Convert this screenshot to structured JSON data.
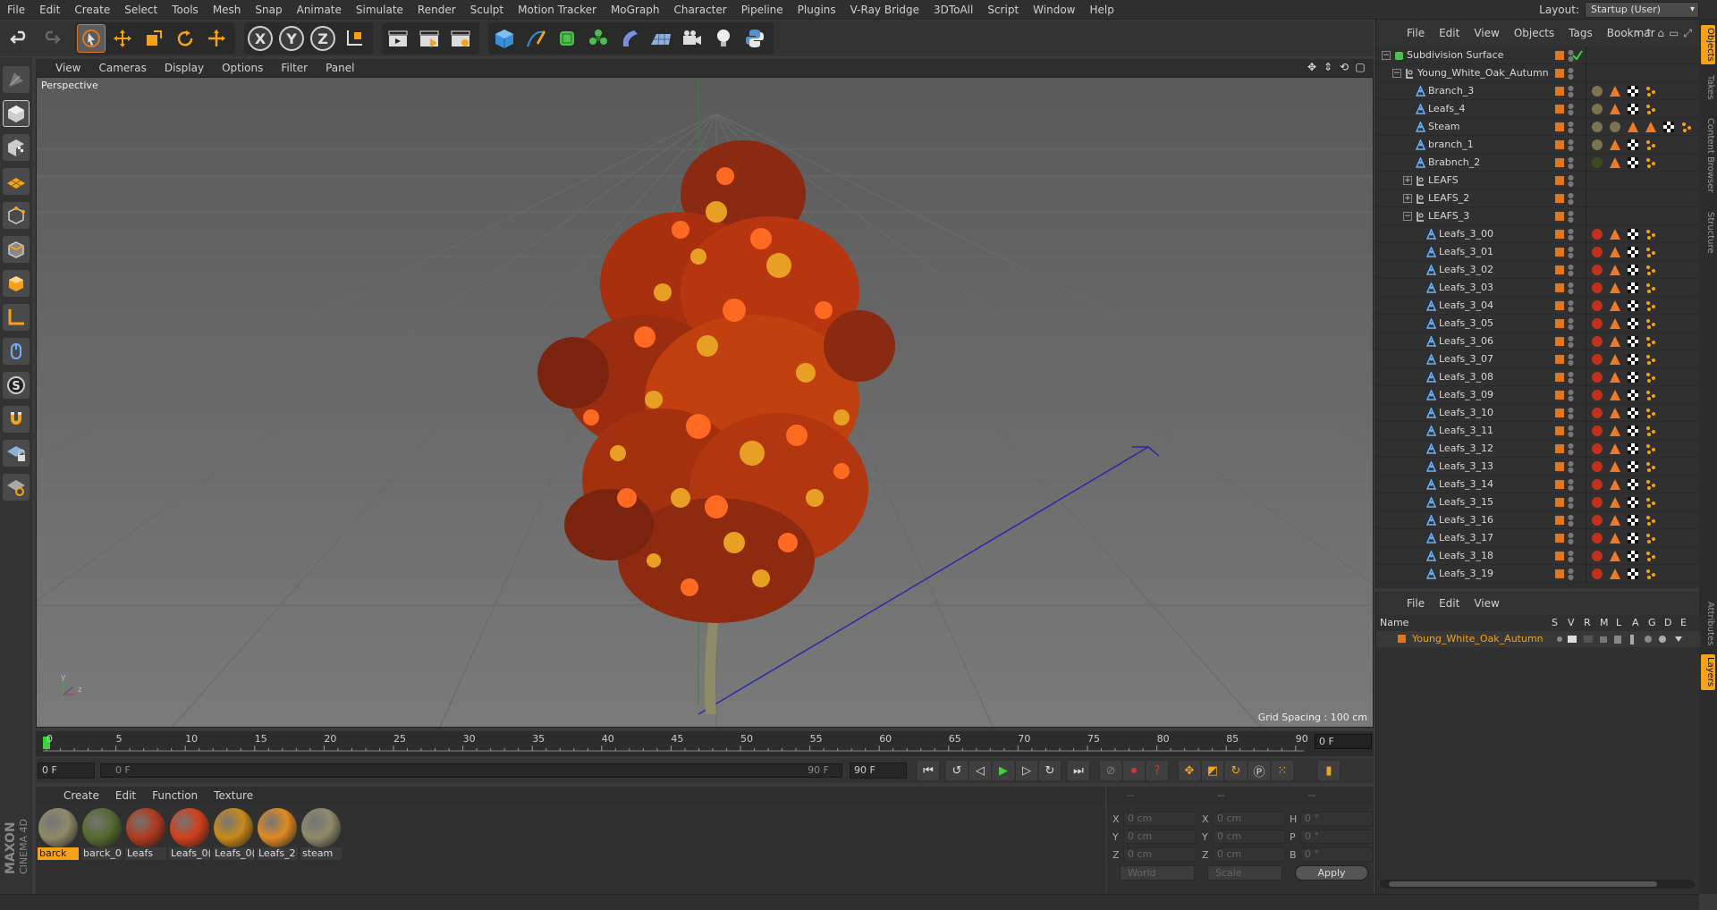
{
  "menubar": {
    "items": [
      "File",
      "Edit",
      "Create",
      "Select",
      "Tools",
      "Mesh",
      "Snap",
      "Animate",
      "Simulate",
      "Render",
      "Sculpt",
      "Motion Tracker",
      "MoGraph",
      "Character",
      "Pipeline",
      "Plugins",
      "V-Ray Bridge",
      "3DToAll",
      "Script",
      "Window",
      "Help"
    ],
    "layout_label": "Layout:",
    "layout_value": "Startup (User)"
  },
  "toolbar": {
    "axis_x": "X",
    "axis_y": "Y",
    "axis_z": "Z"
  },
  "viewport": {
    "menus": [
      "View",
      "Cameras",
      "Display",
      "Options",
      "Filter",
      "Panel"
    ],
    "label": "Perspective",
    "grid_spacing": "Grid Spacing : 100 cm",
    "axis_y": "y",
    "axis_z": "z"
  },
  "timeline": {
    "ticks": [
      "0",
      "5",
      "10",
      "15",
      "20",
      "25",
      "30",
      "35",
      "40",
      "45",
      "50",
      "55",
      "60",
      "65",
      "70",
      "75",
      "80",
      "85",
      "90"
    ],
    "current_frame": "0 F"
  },
  "playbar": {
    "start_field": "0 F",
    "range_start": "0 F",
    "range_end": "90 F",
    "end_field": "90 F"
  },
  "materials": {
    "menus": [
      "Create",
      "Edit",
      "Function",
      "Texture"
    ],
    "items": [
      {
        "name": "barck",
        "color": "#8f8a68"
      },
      {
        "name": "barck_0(",
        "color": "#556b2f"
      },
      {
        "name": "Leafs",
        "color": "#b03a1e"
      },
      {
        "name": "Leafs_0(",
        "color": "#d2401a"
      },
      {
        "name": "Leafs_0(",
        "color": "#c98a1a"
      },
      {
        "name": "Leafs_2",
        "color": "#e08a22"
      },
      {
        "name": "steam",
        "color": "#8f8a68"
      }
    ]
  },
  "coords": {
    "header": [
      "--",
      "--",
      "--"
    ],
    "rows": [
      {
        "a_label": "X",
        "a_value": "0 cm",
        "b_label": "X",
        "b_value": "0 cm",
        "c_label": "H",
        "c_value": "0 °"
      },
      {
        "a_label": "Y",
        "a_value": "0 cm",
        "b_label": "Y",
        "b_value": "0 cm",
        "c_label": "P",
        "c_value": "0 °"
      },
      {
        "a_label": "Z",
        "a_value": "0 cm",
        "b_label": "Z",
        "b_value": "0 cm",
        "c_label": "B",
        "c_value": "0 °"
      }
    ],
    "mode": "World",
    "scale": "Scale",
    "apply": "Apply"
  },
  "object_manager": {
    "menus": [
      "File",
      "Edit",
      "View",
      "Objects",
      "Tags",
      "Bookmar"
    ],
    "rows": [
      {
        "name": "Subdivision Surface",
        "indent": 0,
        "kind": "subdiv"
      },
      {
        "name": "Young_White_Oak_Autumn",
        "indent": 1,
        "kind": "null"
      },
      {
        "name": "Branch_3",
        "indent": 2,
        "kind": "poly",
        "tags": "bark"
      },
      {
        "name": "Leafs_4",
        "indent": 2,
        "kind": "poly",
        "tags": "bark"
      },
      {
        "name": "Steam",
        "indent": 2,
        "kind": "poly",
        "tags": "steam"
      },
      {
        "name": "branch_1",
        "indent": 2,
        "kind": "poly",
        "tags": "bark"
      },
      {
        "name": "Brabnch_2",
        "indent": 2,
        "kind": "poly",
        "tags": "green"
      },
      {
        "name": "LEAFS",
        "indent": 2,
        "kind": "null"
      },
      {
        "name": "LEAFS_2",
        "indent": 2,
        "kind": "null"
      },
      {
        "name": "LEAFS_3",
        "indent": 2,
        "kind": "null"
      },
      {
        "name": "Leafs_3_00",
        "indent": 3,
        "kind": "poly",
        "tags": "leaf"
      },
      {
        "name": "Leafs_3_01",
        "indent": 3,
        "kind": "poly",
        "tags": "leaf"
      },
      {
        "name": "Leafs_3_02",
        "indent": 3,
        "kind": "poly",
        "tags": "leaf"
      },
      {
        "name": "Leafs_3_03",
        "indent": 3,
        "kind": "poly",
        "tags": "leaf"
      },
      {
        "name": "Leafs_3_04",
        "indent": 3,
        "kind": "poly",
        "tags": "leaf"
      },
      {
        "name": "Leafs_3_05",
        "indent": 3,
        "kind": "poly",
        "tags": "leaf"
      },
      {
        "name": "Leafs_3_06",
        "indent": 3,
        "kind": "poly",
        "tags": "leaf"
      },
      {
        "name": "Leafs_3_07",
        "indent": 3,
        "kind": "poly",
        "tags": "leaf"
      },
      {
        "name": "Leafs_3_08",
        "indent": 3,
        "kind": "poly",
        "tags": "leaf"
      },
      {
        "name": "Leafs_3_09",
        "indent": 3,
        "kind": "poly",
        "tags": "leaf"
      },
      {
        "name": "Leafs_3_10",
        "indent": 3,
        "kind": "poly",
        "tags": "leaf"
      },
      {
        "name": "Leafs_3_11",
        "indent": 3,
        "kind": "poly",
        "tags": "leaf"
      },
      {
        "name": "Leafs_3_12",
        "indent": 3,
        "kind": "poly",
        "tags": "leaf"
      },
      {
        "name": "Leafs_3_13",
        "indent": 3,
        "kind": "poly",
        "tags": "leaf"
      },
      {
        "name": "Leafs_3_14",
        "indent": 3,
        "kind": "poly",
        "tags": "leaf"
      },
      {
        "name": "Leafs_3_15",
        "indent": 3,
        "kind": "poly",
        "tags": "leaf"
      },
      {
        "name": "Leafs_3_16",
        "indent": 3,
        "kind": "poly",
        "tags": "leaf"
      },
      {
        "name": "Leafs_3_17",
        "indent": 3,
        "kind": "poly",
        "tags": "leaf"
      },
      {
        "name": "Leafs_3_18",
        "indent": 3,
        "kind": "poly",
        "tags": "leaf"
      },
      {
        "name": "Leafs_3_19",
        "indent": 3,
        "kind": "poly",
        "tags": "leaf"
      }
    ]
  },
  "right_tabs": [
    "Objects",
    "Takes",
    "Content Browser",
    "Structure",
    "Attributes",
    "Layers"
  ],
  "layer_manager": {
    "menus": [
      "File",
      "Edit",
      "View"
    ],
    "columns": [
      "Name",
      "S",
      "V",
      "R",
      "M",
      "L",
      "A",
      "G",
      "D",
      "E"
    ],
    "layer_name": "Young_White_Oak_Autumn"
  },
  "colors": {
    "accent": "#f5a21b",
    "layer_swatch": "#e0761e",
    "leaf_orange": "#d2401a",
    "leaf_yellow": "#e8a024"
  }
}
